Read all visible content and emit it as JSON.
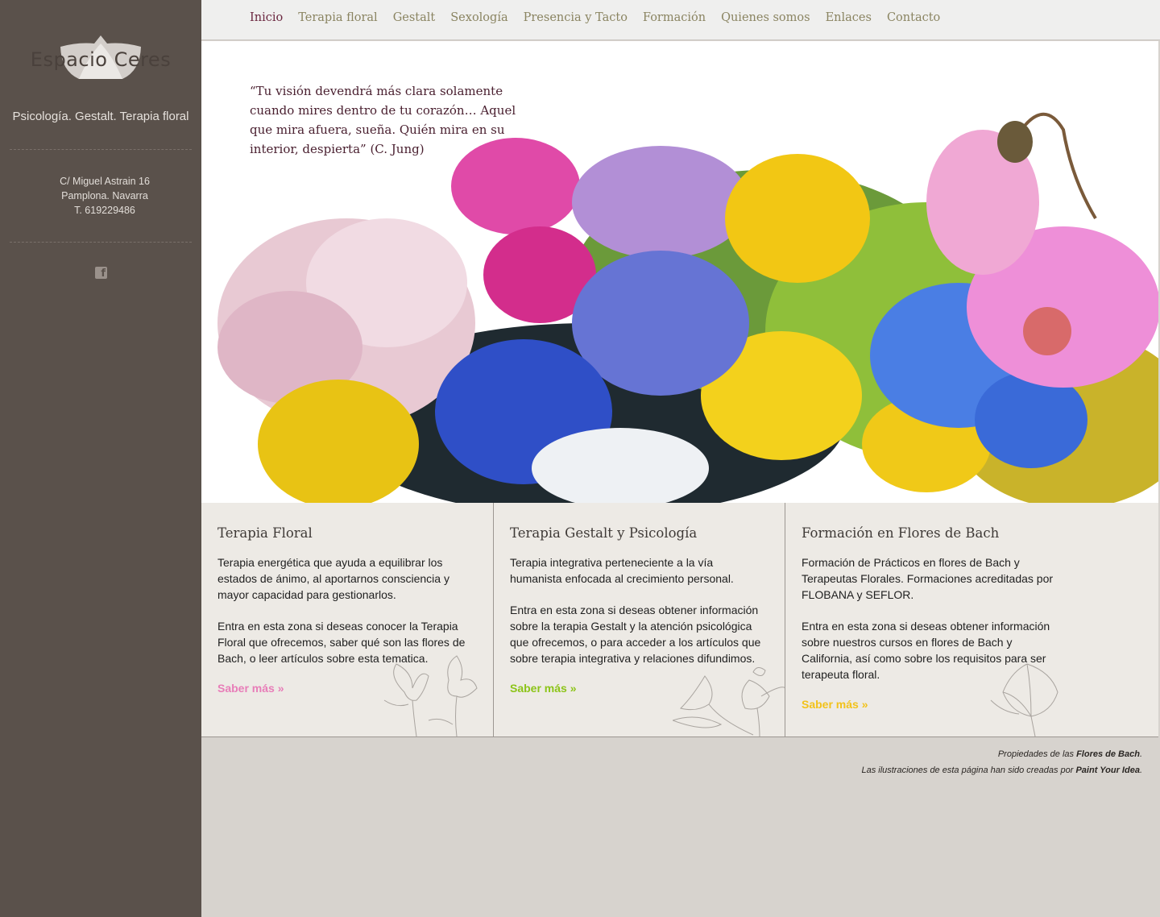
{
  "sidebar": {
    "logo_name": "Espacio Ceres",
    "tagline": "Psicología. Gestalt. Terapia floral",
    "address": {
      "street": "C/ Miguel Astrain 16",
      "city": "Pamplona. Navarra",
      "phone": "T. 619229486"
    },
    "social_icon": "facebook-icon"
  },
  "nav": {
    "items": [
      "Inicio",
      "Terapia floral",
      "Gestalt",
      "Sexología",
      "Presencia y Tacto",
      "Formación",
      "Quienes somos",
      "Enlaces",
      "Contacto"
    ],
    "active": "Inicio"
  },
  "hero": {
    "quote": "“Tu visión devendrá más clara solamente cuando mires dentro de tu corazón… Aquel que mira afuera, sueña. Quién mira en su interior, despierta” (C. Jung)"
  },
  "cards": [
    {
      "title": "Terapia Floral",
      "text1": "Terapia energética que ayuda a equilibrar los estados de ánimo, al aportarnos consciencia y mayor capacidad para gestionarlos.",
      "text2": "Entra en esta zona si deseas conocer la Terapia Floral que ofrecemos, saber qué son las flores de Bach, o leer artículos sobre esta tematica.",
      "link": "Saber más »",
      "link_color": "#e87db8"
    },
    {
      "title": "Terapia Gestalt y Psicología",
      "text1": "Terapia integrativa perteneciente a la vía humanista enfocada al crecimiento personal.",
      "text2": "Entra en esta zona si deseas obtener información sobre la terapia Gestalt y la atención psicológica que ofrecemos, o para acceder a los artículos que sobre terapia integrativa y relaciones difundimos.",
      "link": "Saber más »",
      "link_color": "#8cc418"
    },
    {
      "title": "Formación en Flores de Bach",
      "text1": "Formación de Prácticos en flores de Bach y Terapeutas Florales. Formaciones acreditadas por FLOBANA y SEFLOR.",
      "text2": "Entra en esta zona si deseas obtener información sobre nuestros cursos en flores de Bach y California, así como sobre los requisitos para ser terapeuta floral.",
      "link": "Saber más »",
      "link_color": "#f2c21a"
    }
  ],
  "footer": {
    "line1_prefix": "Propiedades de las ",
    "line1_link": "Flores de Bach",
    "line1_suffix": ".",
    "line2_prefix": "Las ilustraciones de esta página han sido creadas por ",
    "line2_link": "Paint Your Idea",
    "line2_suffix": "."
  }
}
